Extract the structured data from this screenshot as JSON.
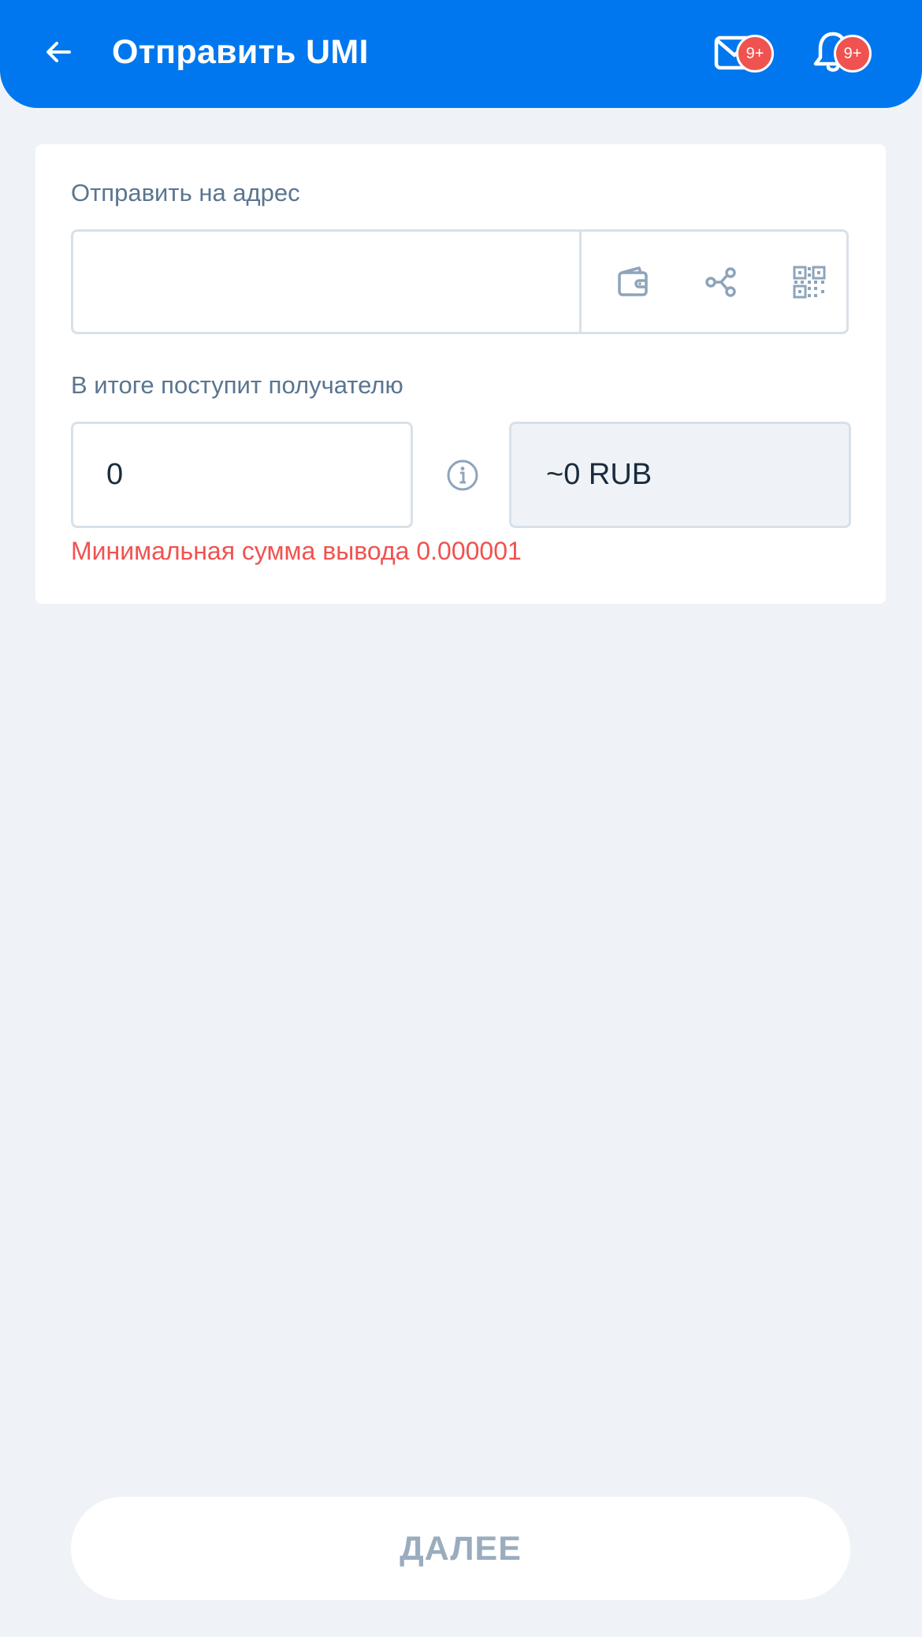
{
  "header": {
    "title": "Отправить UMI",
    "mail_badge": "9+",
    "notifications_badge": "9+"
  },
  "form": {
    "address_label": "Отправить на адрес",
    "address_value": "",
    "amount_label": "В итоге поступит получателю",
    "amount_value": "0",
    "converted_value": "~0 RUB",
    "error": "Минимальная сумма вывода 0.000001"
  },
  "footer": {
    "next_label": "ДАЛЕЕ"
  },
  "colors": {
    "accent": "#0077ee",
    "background": "#eff3f7",
    "error": "#f0524f",
    "badge": "#f0524f",
    "icon_muted": "#8da4bb",
    "disabled_text": "#9aacbe"
  },
  "icons": [
    "arrow-left-icon",
    "mail-icon",
    "bell-icon",
    "wallet-icon",
    "share-icon",
    "qr-code-icon",
    "info-icon"
  ]
}
